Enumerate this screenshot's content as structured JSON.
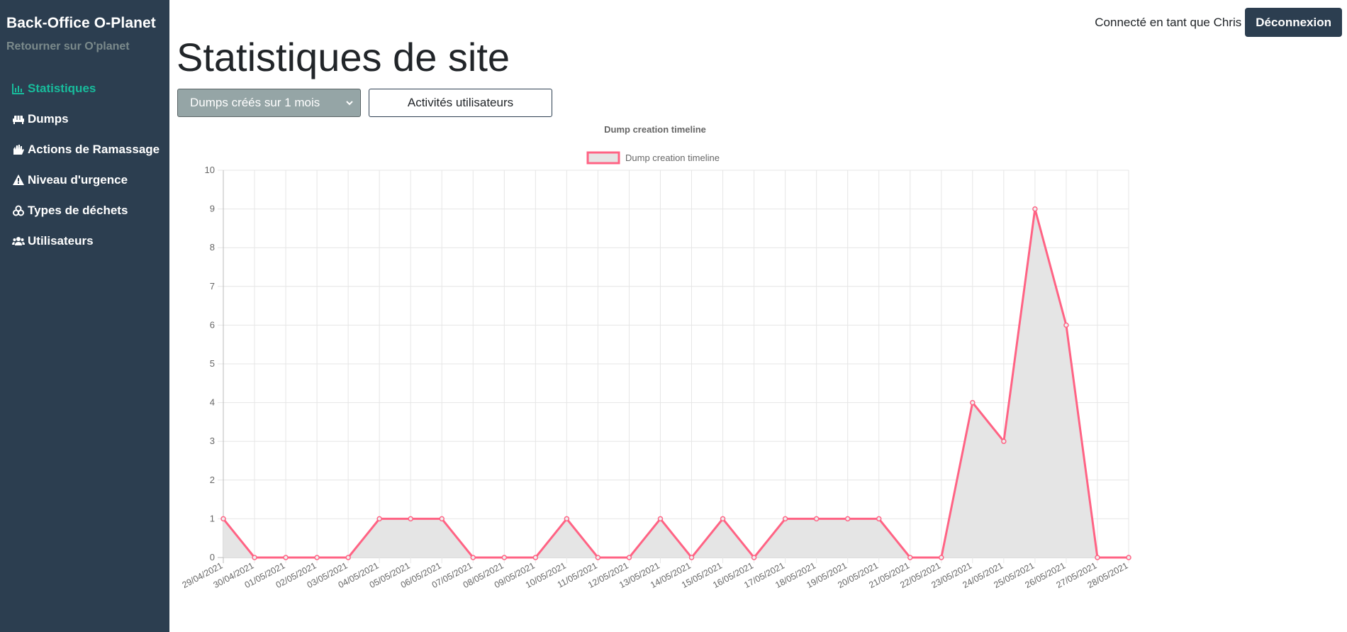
{
  "sidebar": {
    "brand": "Back-Office O-Planet",
    "back_link": "Retourner sur O'planet",
    "items": [
      {
        "label": "Statistiques",
        "icon": "chart-bar-icon",
        "active": true
      },
      {
        "label": "Dumps",
        "icon": "couch-icon",
        "active": false
      },
      {
        "label": "Actions de Ramassage",
        "icon": "hands-icon",
        "active": false
      },
      {
        "label": "Niveau d'urgence",
        "icon": "warning-triangle-icon",
        "active": false
      },
      {
        "label": "Types de déchets",
        "icon": "biohazard-icon",
        "active": false
      },
      {
        "label": "Utilisateurs",
        "icon": "users-icon",
        "active": false
      }
    ]
  },
  "header": {
    "user_text": "Connecté en tant que Chris",
    "logout_label": "Déconnexion"
  },
  "page": {
    "title": "Statistiques de site",
    "select_value": "Dumps créés sur 1 mois",
    "activity_button": "Activités utilisateurs"
  },
  "colors": {
    "sidebar_bg": "#2c3e50",
    "accent": "#18bc9c",
    "line": "#ff6384",
    "area_fill": "#e5e5e5"
  },
  "chart_data": {
    "type": "area",
    "title": "Dump creation timeline",
    "legend": "top",
    "grid": true,
    "ylim": [
      0,
      10
    ],
    "yticks": [
      0,
      1,
      2,
      3,
      4,
      5,
      6,
      7,
      8,
      9,
      10
    ],
    "x": [
      "29/04/2021",
      "30/04/2021",
      "01/05/2021",
      "02/05/2021",
      "03/05/2021",
      "04/05/2021",
      "05/05/2021",
      "06/05/2021",
      "07/05/2021",
      "08/05/2021",
      "09/05/2021",
      "10/05/2021",
      "11/05/2021",
      "12/05/2021",
      "13/05/2021",
      "14/05/2021",
      "15/05/2021",
      "16/05/2021",
      "17/05/2021",
      "18/05/2021",
      "19/05/2021",
      "20/05/2021",
      "21/05/2021",
      "22/05/2021",
      "23/05/2021",
      "24/05/2021",
      "25/05/2021",
      "26/05/2021",
      "27/05/2021",
      "28/05/2021"
    ],
    "series": [
      {
        "name": "Dump creation timeline",
        "values": [
          1,
          0,
          0,
          0,
          0,
          1,
          1,
          1,
          0,
          0,
          0,
          1,
          0,
          0,
          1,
          0,
          1,
          0,
          1,
          1,
          1,
          1,
          0,
          0,
          4,
          3,
          9,
          6,
          0,
          0
        ]
      }
    ]
  }
}
